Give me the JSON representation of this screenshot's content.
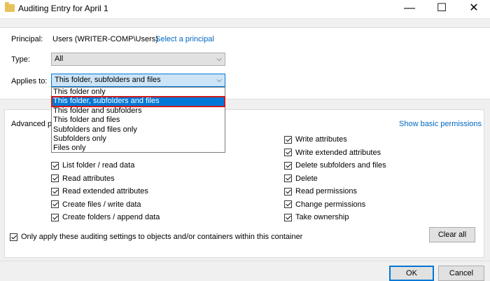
{
  "window": {
    "title": "Auditing Entry for April 1",
    "minimize": "—",
    "maximize": "☐",
    "close": "✕"
  },
  "principal": {
    "label": "Principal:",
    "value": "Users (WRITER-COMP\\Users)",
    "link": "Select a principal"
  },
  "type": {
    "label": "Type:",
    "value": "All"
  },
  "applies_to": {
    "label": "Applies to:",
    "value": "This folder, subfolders and files",
    "options": [
      "This folder only",
      "This folder, subfolders and files",
      "This folder and subfolders",
      "This folder and files",
      "Subfolders and files only",
      "Subfolders only",
      "Files only"
    ]
  },
  "advanced": {
    "label_visible": "Advanced p",
    "show_basic_link": "Show basic permissions",
    "left_permissions": [
      "List folder / read data",
      "Read attributes",
      "Read extended attributes",
      "Create files / write data",
      "Create folders / append data"
    ],
    "right_permissions": [
      "Write attributes",
      "Write extended attributes",
      "Delete subfolders and files",
      "Delete",
      "Read permissions",
      "Change permissions",
      "Take ownership"
    ]
  },
  "only_apply": "Only apply these auditing settings to objects and/or containers within this container",
  "buttons": {
    "clear_all": "Clear all",
    "ok": "OK",
    "cancel": "Cancel"
  },
  "colors": {
    "accent": "#0078d7",
    "link": "#0067c0",
    "highlight_outline": "#d11a1a"
  }
}
